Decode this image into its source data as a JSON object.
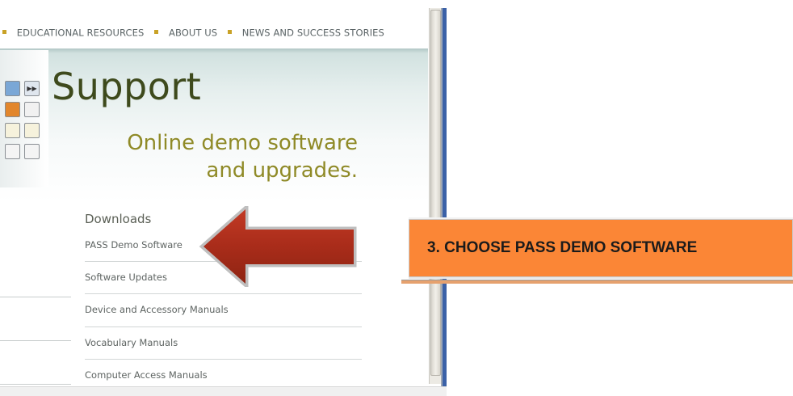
{
  "nav": {
    "items": [
      {
        "label": "EDUCATIONAL RESOURCES"
      },
      {
        "label": "ABOUT US"
      },
      {
        "label": "NEWS AND SUCCESS STORIES"
      }
    ],
    "bullet_color": "#c9a227"
  },
  "banner": {
    "title": "Support",
    "subtitle_line1": "Online demo software",
    "subtitle_line2": "and upgrades.",
    "title_color": "#3e4a1c",
    "subtitle_color": "#8f8a27"
  },
  "downloads": {
    "heading": "Downloads",
    "items": [
      {
        "label": "PASS Demo Software"
      },
      {
        "label": "Software Updates"
      },
      {
        "label": "Device and Accessory Manuals"
      },
      {
        "label": "Vocabulary Manuals"
      },
      {
        "label": "Computer Access Manuals"
      }
    ]
  },
  "annotation": {
    "callout_text": "3. CHOOSE PASS DEMO SOFTWARE",
    "callout_color": "#fb8636",
    "arrow_color": "#b1331f",
    "arrow_icon": "left-arrow-icon"
  }
}
